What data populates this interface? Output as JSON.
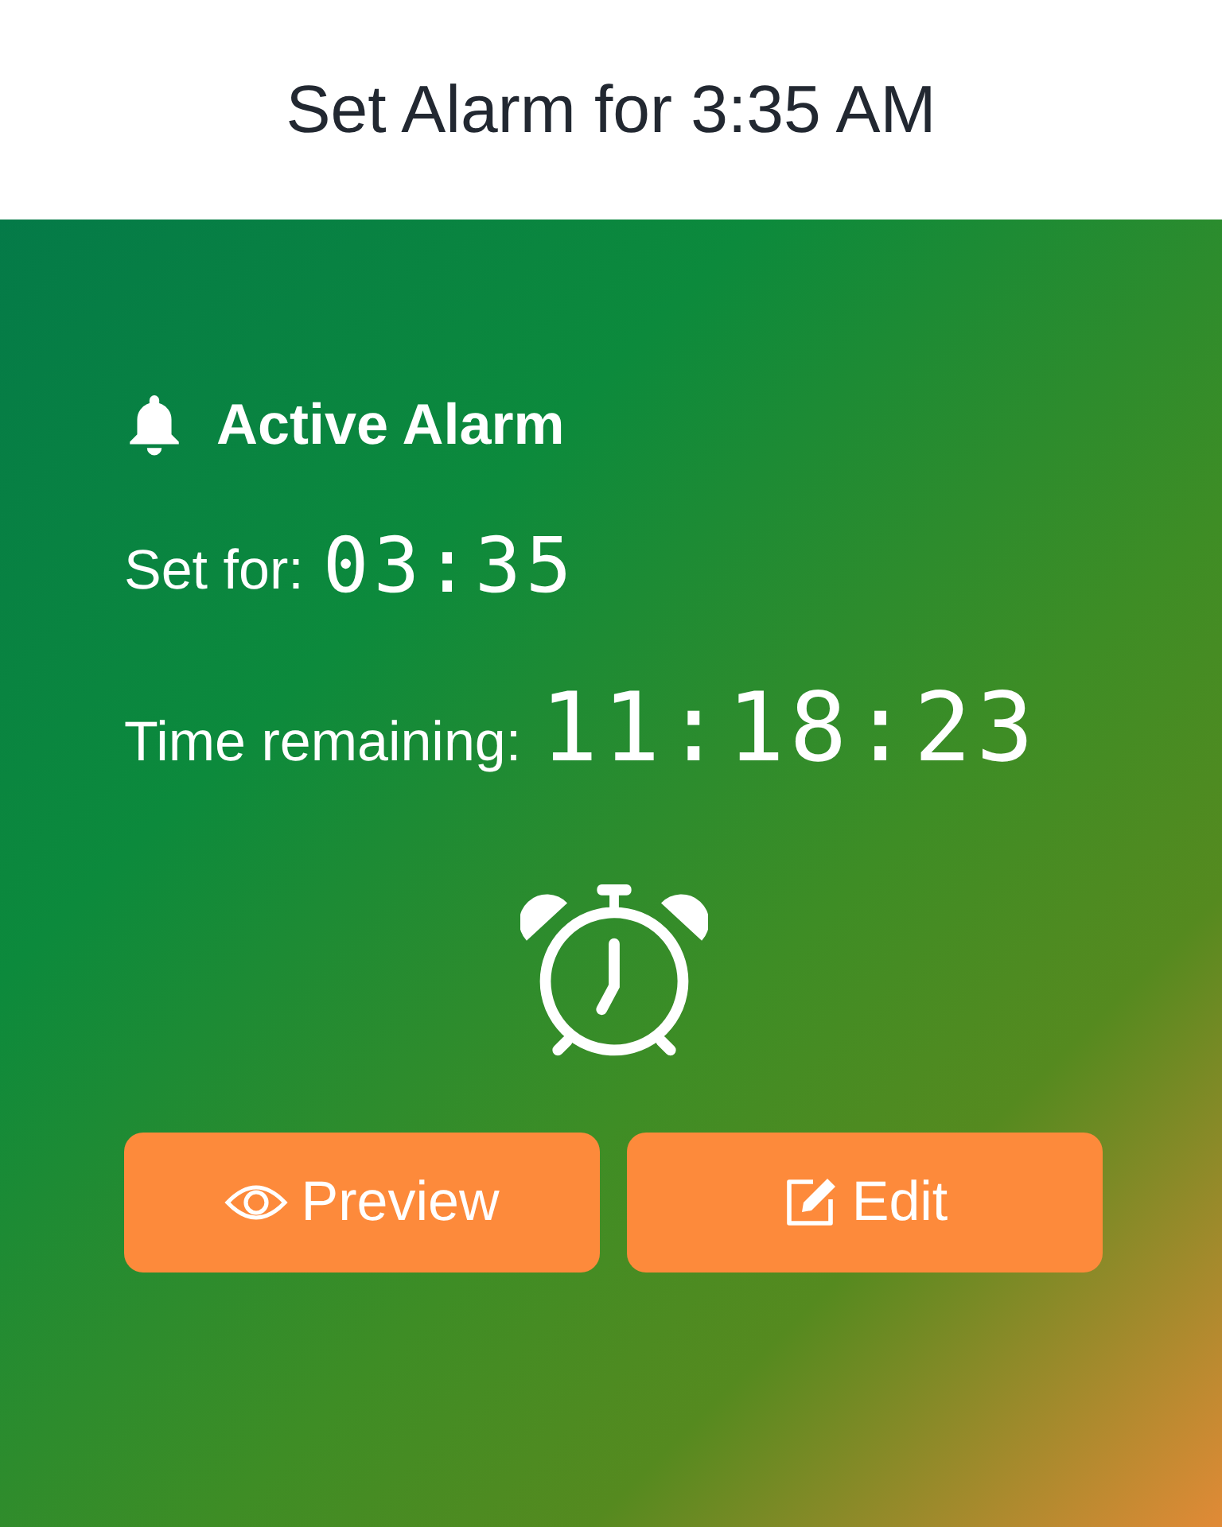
{
  "header": {
    "title": "Set Alarm for 3:35 AM"
  },
  "alarm": {
    "heading": "Active Alarm",
    "set_for_label": "Set for:",
    "set_for_value": "03:35",
    "remaining_label": "Time remaining:",
    "remaining_value": "11:18:23"
  },
  "buttons": [
    {
      "kind": "preview",
      "label": "Preview"
    },
    {
      "kind": "edit",
      "label": "Edit"
    }
  ]
}
